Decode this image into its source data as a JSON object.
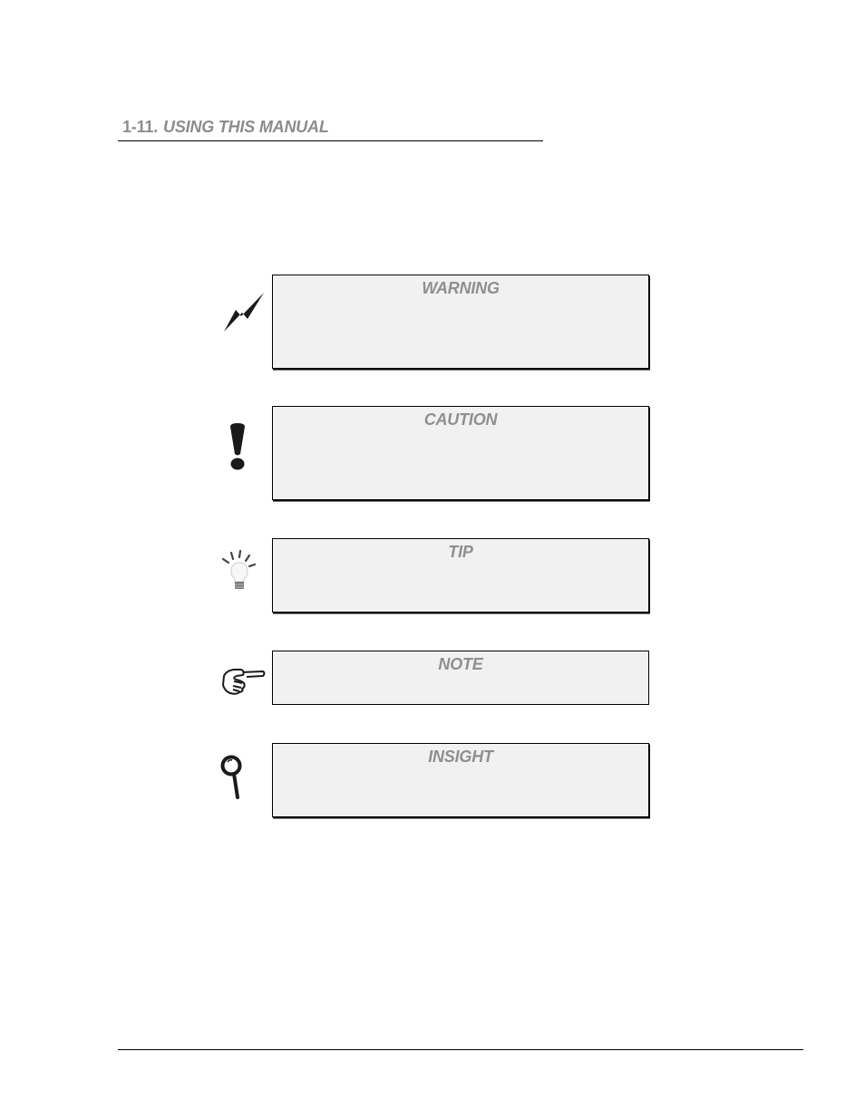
{
  "section": {
    "number": "1-11.",
    "title": "USING THIS MANUAL"
  },
  "notices": [
    {
      "type": "warning",
      "title": "WARNING",
      "icon": "lightning-bolt-icon"
    },
    {
      "type": "caution",
      "title": "CAUTION",
      "icon": "exclamation-icon"
    },
    {
      "type": "tip",
      "title": "TIP",
      "icon": "lightbulb-icon"
    },
    {
      "type": "note",
      "title": "NOTE",
      "icon": "pointing-hand-icon"
    },
    {
      "type": "insight",
      "title": "INSIGHT",
      "icon": "magnifying-glass-icon"
    }
  ],
  "colors": {
    "heading_text": "#8c8c8c",
    "box_background": "#f1f1f1",
    "box_border": "#000000"
  }
}
